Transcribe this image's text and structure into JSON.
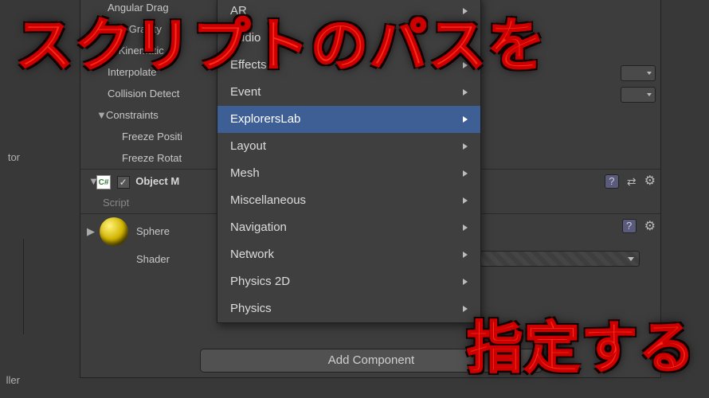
{
  "left_panel": {
    "label": "tor",
    "label2": "ller"
  },
  "inspector": {
    "rigidbody": {
      "angularDrag": "Angular Drag",
      "useGravity": "Use Gravity",
      "isKinematic": "Is Kinematic",
      "interpolate": "Interpolate",
      "collisionDetect": "Collision Detect",
      "constraints": "Constraints",
      "freezePosition": "Freeze Positi",
      "freezeRotation": "Freeze Rotat"
    },
    "scriptComp": {
      "icon": "C#",
      "title": "Object M",
      "scriptLabel": "Script"
    },
    "material": {
      "name": "Sphere",
      "shaderLabel": "Shader",
      "shaderValue": ""
    },
    "addComponent": "Add Component"
  },
  "menu": {
    "items": [
      {
        "label": "AR",
        "sub": true
      },
      {
        "label": "Audio",
        "sub": true
      },
      {
        "label": "Effects",
        "sub": true
      },
      {
        "label": "Event",
        "sub": true
      },
      {
        "label": "ExplorersLab",
        "sub": true,
        "highlight": true
      },
      {
        "label": "Layout",
        "sub": true
      },
      {
        "label": "Mesh",
        "sub": true
      },
      {
        "label": "Miscellaneous",
        "sub": true
      },
      {
        "label": "Navigation",
        "sub": true
      },
      {
        "label": "Network",
        "sub": true
      },
      {
        "label": "Physics 2D",
        "sub": true
      },
      {
        "label": "Physics",
        "sub": true
      }
    ]
  },
  "headline": {
    "top": "スクリプトのパスを",
    "bottom": "指定する"
  }
}
